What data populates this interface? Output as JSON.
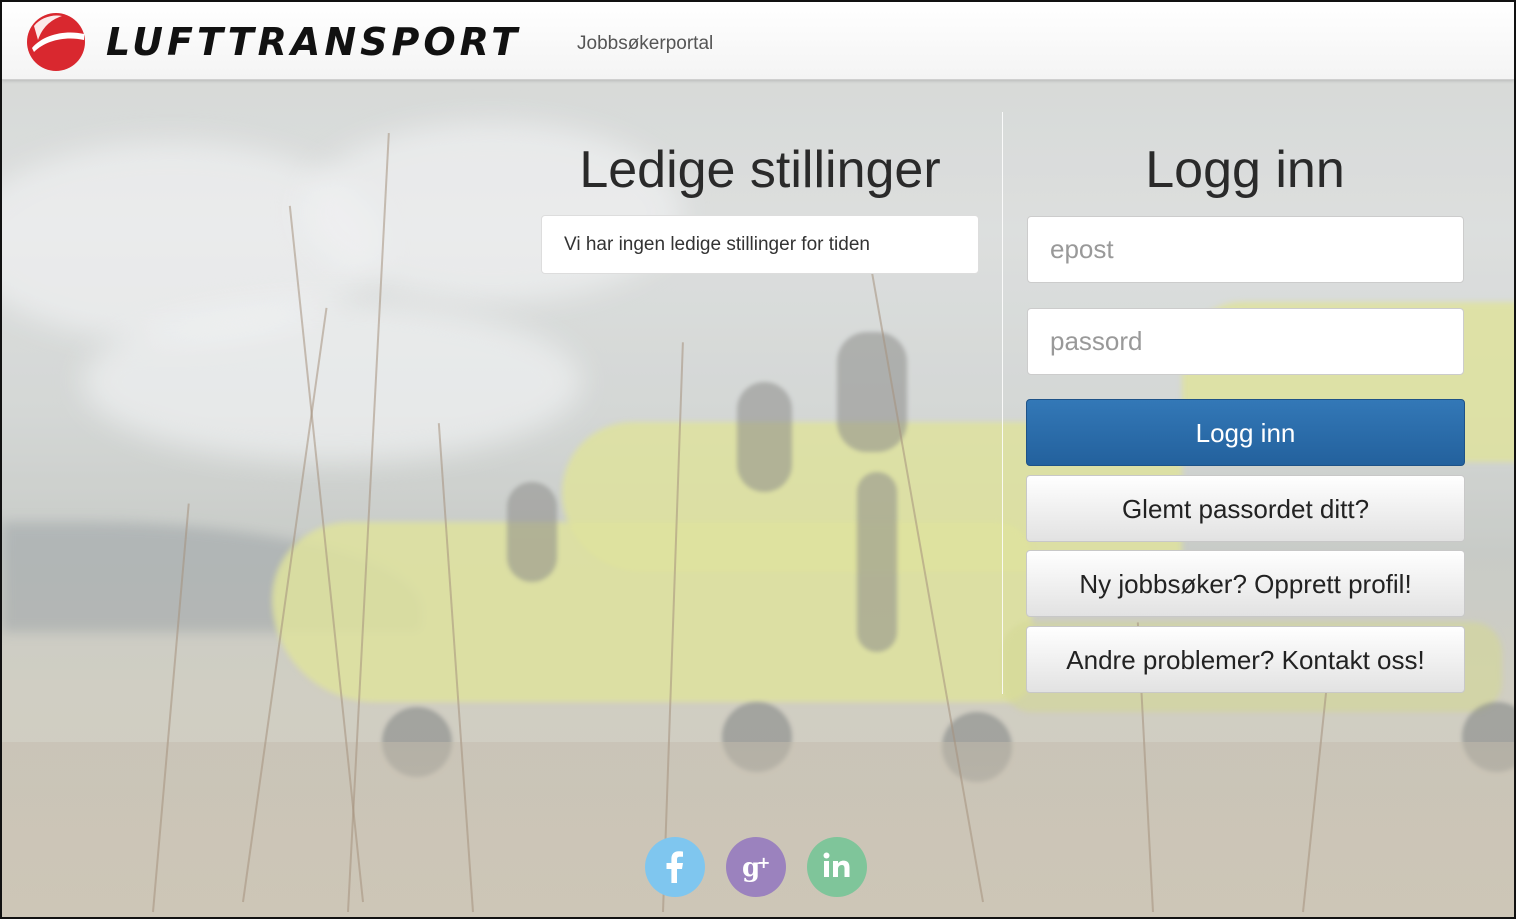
{
  "header": {
    "brand": "LUFTTRANSPORT",
    "portal_label": "Jobbsøkerportal"
  },
  "jobs": {
    "title": "Ledige stillinger",
    "empty_message": "Vi har ingen ledige stillinger for tiden"
  },
  "login": {
    "title": "Logg inn",
    "email_placeholder": "epost",
    "email_value": "",
    "password_placeholder": "passord",
    "password_value": "",
    "submit_label": "Logg inn",
    "forgot_label": "Glemt passordet ditt?",
    "register_label": "Ny jobbsøker? Opprett profil!",
    "contact_label": "Andre problemer? Kontakt oss!"
  },
  "social": [
    {
      "icon": "facebook-icon",
      "color": "#7fc6ef"
    },
    {
      "icon": "google-plus-icon",
      "color": "#9b82be"
    },
    {
      "icon": "linkedin-icon",
      "color": "#7fc59a"
    }
  ],
  "colors": {
    "brand_red": "#d9282f",
    "primary_button": "#2a6aa9"
  }
}
